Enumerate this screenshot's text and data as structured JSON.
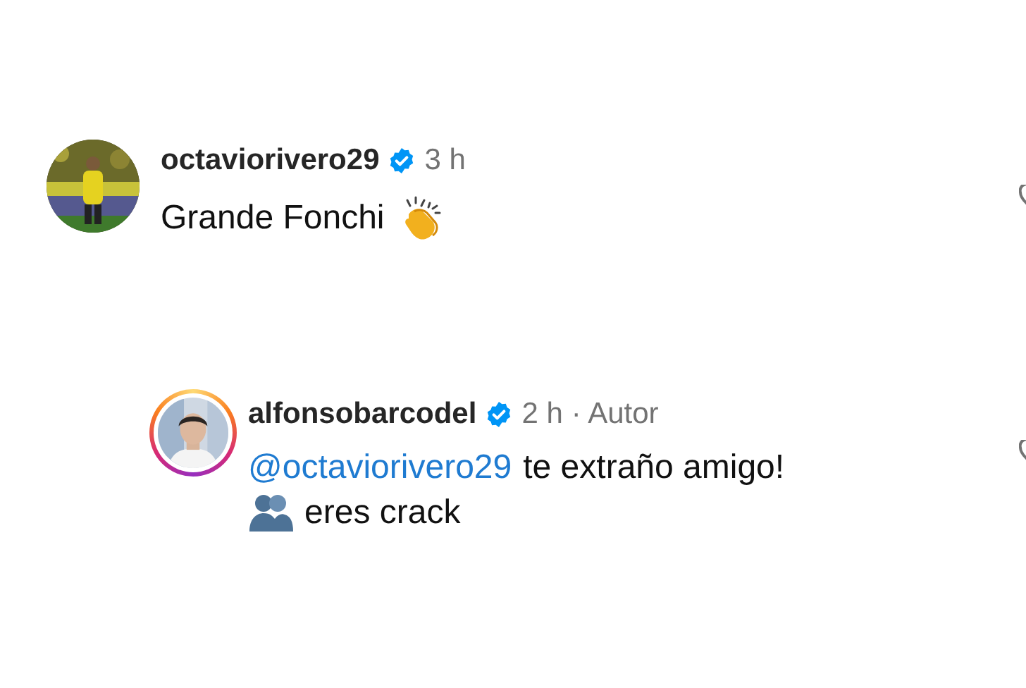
{
  "comments": [
    {
      "kind": "comment",
      "username": "octaviorivero29",
      "verified": true,
      "story_ring": false,
      "time": "3 h",
      "lines": [
        [
          {
            "kind": "text",
            "text": "Grande Fonchi"
          },
          {
            "kind": "clap"
          }
        ]
      ]
    },
    {
      "kind": "reply",
      "username": "alfonsobarcodel",
      "verified": true,
      "story_ring": true,
      "time": "2 h",
      "author_tag": "· Autor",
      "lines": [
        [
          {
            "kind": "mention",
            "text": "@octaviorivero29"
          },
          {
            "kind": "text",
            "text": "te extraño amigo!"
          }
        ],
        [
          {
            "kind": "hug"
          },
          {
            "kind": "text",
            "text": "eres crack"
          }
        ]
      ]
    }
  ]
}
